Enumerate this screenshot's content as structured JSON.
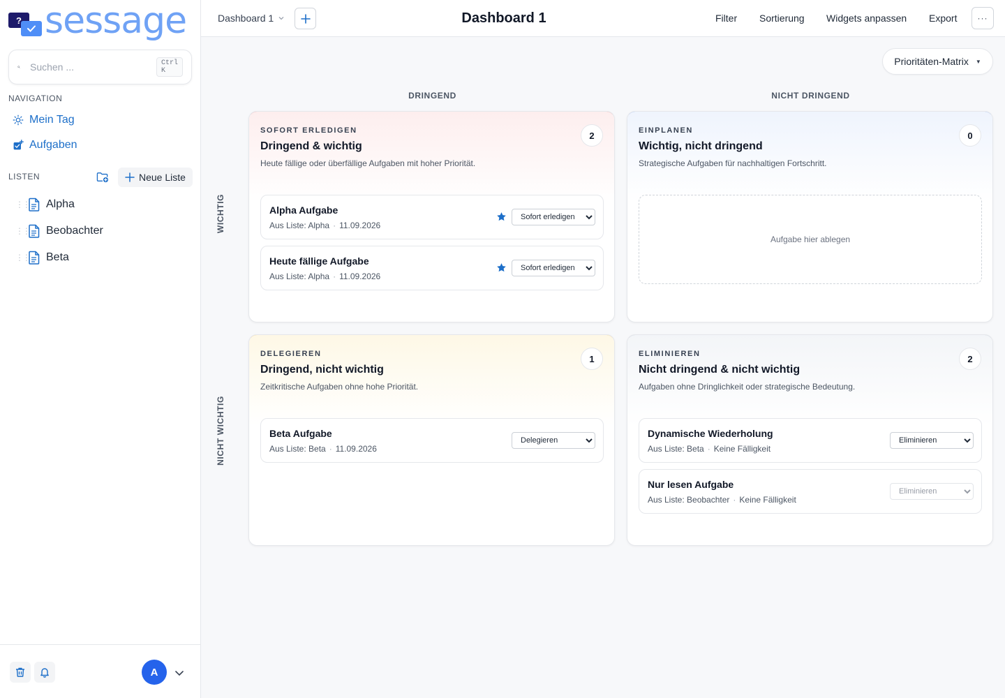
{
  "brand": {
    "name": "sessage",
    "mark_glyph": "?"
  },
  "search": {
    "placeholder": "Suchen ...",
    "shortcut": "Ctrl K"
  },
  "sidebar": {
    "navigation_label": "NAVIGATION",
    "nav_items": [
      {
        "label": "Mein Tag",
        "icon": "sun-icon"
      },
      {
        "label": "Aufgaben",
        "icon": "tasks-icon"
      }
    ],
    "lists_label": "LISTEN",
    "new_list_label": "Neue Liste",
    "lists": [
      {
        "label": "Alpha",
        "icon": "document-icon"
      },
      {
        "label": "Beobachter",
        "icon": "document-icon"
      },
      {
        "label": "Beta",
        "icon": "document-icon"
      }
    ],
    "user_initial": "A"
  },
  "topbar": {
    "dashboard_select": "Dashboard 1",
    "title": "Dashboard 1",
    "actions": [
      "Filter",
      "Sortierung",
      "Widgets anpassen",
      "Export"
    ],
    "more": "···"
  },
  "matrix": {
    "view_select": "Prioritäten-Matrix",
    "col_headers": [
      "DRINGEND",
      "NICHT DRINGEND"
    ],
    "row_headers": [
      "WICHTIG",
      "NICHT WICHTIG"
    ],
    "status_options": [
      "Sofort erledigen",
      "Einplanen",
      "Delegieren",
      "Eliminieren"
    ],
    "quadrants": [
      {
        "kicker": "SOFORT ERLEDIGEN",
        "title": "Dringend & wichtig",
        "description": "Heute fällige oder überfällige Aufgaben mit hoher Priorität.",
        "count": "2",
        "accent": "#e5484d",
        "tint": "#fdeeee",
        "tasks": [
          {
            "title": "Alpha Aufgabe",
            "list": "Aus Liste: Alpha",
            "due": "11.09.2026",
            "starred": true,
            "status": "Sofort erledigen"
          },
          {
            "title": "Heute fällige Aufgabe",
            "list": "Aus Liste: Alpha",
            "due": "11.09.2026",
            "starred": true,
            "status": "Sofort erledigen"
          }
        ]
      },
      {
        "kicker": "EINPLANEN",
        "title": "Wichtig, nicht dringend",
        "description": "Strategische Aufgaben für nachhaltigen Fortschritt.",
        "count": "0",
        "accent": "#2563eb",
        "tint": "#eff4fd",
        "drop_text": "Aufgabe hier ablegen",
        "tasks": []
      },
      {
        "kicker": "DELEGIEREN",
        "title": "Dringend, nicht wichtig",
        "description": "Zeitkritische Aufgaben ohne hohe Priorität.",
        "count": "1",
        "accent": "#f59e0b",
        "tint": "#fef8e6",
        "tasks": [
          {
            "title": "Beta Aufgabe",
            "list": "Aus Liste: Beta",
            "due": "11.09.2026",
            "starred": false,
            "status": "Delegieren"
          }
        ]
      },
      {
        "kicker": "ELIMINIEREN",
        "title": "Nicht dringend & nicht wichtig",
        "description": "Aufgaben ohne Dringlichkeit oder strategische Bedeutung.",
        "count": "2",
        "accent": "#94a3b8",
        "tint": "#f3f5f8",
        "tasks": [
          {
            "title": "Dynamische Wiederholung",
            "list": "Aus Liste: Beta",
            "due": "Keine Fälligkeit",
            "starred": false,
            "status": "Eliminieren"
          },
          {
            "title": "Nur lesen Aufgabe",
            "list": "Aus Liste: Beobachter",
            "due": "Keine Fälligkeit",
            "starred": false,
            "status": "Eliminieren",
            "readonly": true
          }
        ]
      }
    ]
  }
}
